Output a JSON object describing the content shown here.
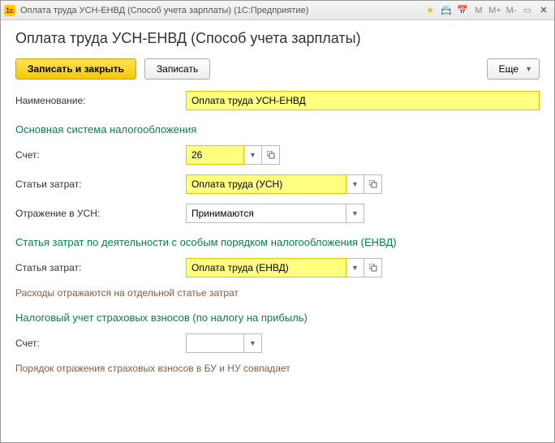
{
  "titlebar": {
    "title": "Оплата труда УСН-ЕНВД (Способ учета зарплаты)  (1С:Предприятие)",
    "m": "M",
    "mplus": "M+",
    "mminus": "M-"
  },
  "heading": "Оплата труда УСН-ЕНВД (Способ учета зарплаты)",
  "toolbar": {
    "save_close": "Записать и закрыть",
    "save": "Записать",
    "more": "Еще"
  },
  "name": {
    "label": "Наименование:",
    "value": "Оплата труда УСН-ЕНВД"
  },
  "section1": {
    "title": "Основная система налогообложения",
    "account_label": "Счет:",
    "account_value": "26",
    "cost_item_label": "Статьи затрат:",
    "cost_item_value": "Оплата труда (УСН)",
    "usn_label": "Отражение в УСН:",
    "usn_value": "Принимаются"
  },
  "section2": {
    "title": "Статья затрат по деятельности с особым порядком налогообложения (ЕНВД)",
    "cost_item_label": "Статья затрат:",
    "cost_item_value": "Оплата труда (ЕНВД)",
    "note": "Расходы отражаются на отдельной статье затрат"
  },
  "section3": {
    "title": "Налоговый учет страховых взносов (по налогу на прибыль)",
    "account_label": "Счет:",
    "account_value": "",
    "note": "Порядок отражения страховых взносов в БУ и НУ совпадает"
  }
}
